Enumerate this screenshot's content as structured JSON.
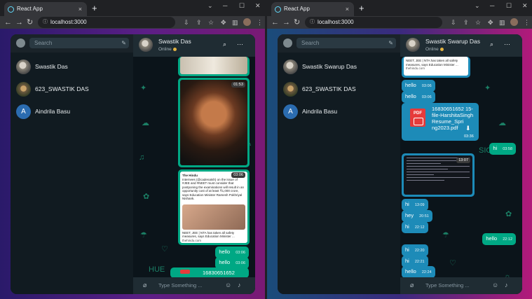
{
  "browser": {
    "tab_title": "React App",
    "url": "localhost:3000",
    "tab_close": "×",
    "new_tab": "+",
    "window_controls": [
      "⌄",
      "─",
      "☐",
      "✕"
    ]
  },
  "left": {
    "search_placeholder": "Search",
    "contacts": [
      {
        "name": "Swastik Das"
      },
      {
        "name": "623_SWASTIK DAS"
      },
      {
        "name": "Aindrila Basu",
        "initial": "A"
      }
    ],
    "chat": {
      "name": "Swastik Das",
      "status": "Online",
      "video_time": "01:53",
      "news_time": "03:06",
      "news_source": "The Hindu",
      "news_text": "Internees (@cadenatsh) on the issue of #JEE and #NEET must consider that postponing the examinations will result in an opportunity cost of at least ₹1,000 crore, says Education Minister Ramesh Pokhriyal Nishank.",
      "news_caption": "NEET, JEE | NTA has taken all safety measures, says Education Minister ...",
      "news_domain": "thehindu.com",
      "messages": [
        {
          "text": "hello",
          "time": "03:06"
        },
        {
          "text": "hello",
          "time": "03:06"
        },
        {
          "text": "16830651652",
          "time": ""
        }
      ],
      "composer_placeholder": "Type Something ..."
    }
  },
  "right": {
    "search_placeholder": "Search",
    "contacts": [
      {
        "name": "Swastik Swarup Das"
      },
      {
        "name": "623_SWASTIK DAS"
      },
      {
        "name": "Aindrila Basu",
        "initial": "A"
      }
    ],
    "chat": {
      "name": "Swastik Swarup Das",
      "status": "Online",
      "news_caption": "NEET, JEE | NTA has taken all safety measures, says Education Minister ...",
      "news_domain": "thehindu.com",
      "hello1": {
        "text": "hello",
        "time": "03:06"
      },
      "hello2": {
        "text": "hello",
        "time": "03:06"
      },
      "file": {
        "name": "16830651652 15-file-HarshitaSingh Resume_Spri ng2023.pdf",
        "time": "03:36",
        "label": "PDF"
      },
      "hi_out": {
        "text": "hi",
        "time": "03:58"
      },
      "screenshot_time": "13:07",
      "incoming": [
        {
          "text": "hi",
          "time": "13:09"
        },
        {
          "text": "hey",
          "time": "20:51"
        },
        {
          "text": "hi",
          "time": "22:12"
        }
      ],
      "hello_out": {
        "text": "hello",
        "time": "22:12"
      },
      "incoming2": [
        {
          "text": "hi",
          "time": "22:20"
        },
        {
          "text": "hi",
          "time": "22:21"
        },
        {
          "text": "hello",
          "time": "22:24"
        }
      ],
      "composer_placeholder": "Type Something ..."
    }
  },
  "icons": {
    "search": "⌕",
    "menu": "⋯",
    "attach": "📎",
    "emoji": "☺",
    "mic": "🎤",
    "pen": "✎",
    "download": "⬇"
  },
  "colors": {
    "outgoing": "#00a884",
    "incoming": "#1d8bb8",
    "panel": "#111b21",
    "header": "#1f2c33",
    "status_dot": "#e3b341"
  }
}
